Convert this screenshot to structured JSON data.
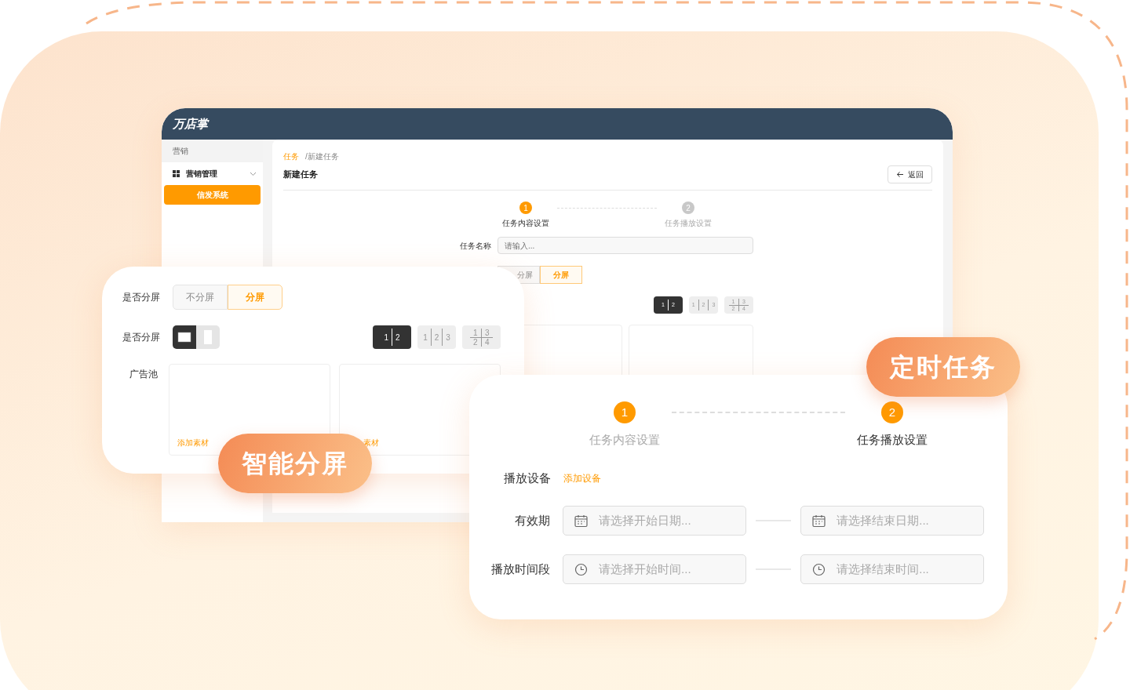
{
  "app": {
    "logo": "万店掌",
    "sidebar": {
      "section": "营销",
      "groups": [
        {
          "label": "营销管理",
          "expanded": true,
          "items": [
            {
              "label": "信发系统",
              "selected": true
            }
          ]
        }
      ]
    },
    "breadcrumb": [
      {
        "label": "任务",
        "kind": "link"
      },
      {
        "label": "/新建任务",
        "kind": "current"
      }
    ],
    "title": "新建任务",
    "back_button": "返回",
    "steps": [
      {
        "number": "1",
        "label": "任务内容设置",
        "reached": true,
        "selected": true
      },
      {
        "number": "2",
        "label": "任务播放设置",
        "reached": false,
        "selected": false
      }
    ],
    "task_name": {
      "label": "任务名称",
      "placeholder": "请输入..."
    },
    "split_options": [
      {
        "label": "分屏",
        "selected": false
      },
      {
        "label": "分屏",
        "selected": true
      }
    ],
    "layouts": [
      {
        "kind": "two",
        "cells": [
          "1",
          "2"
        ],
        "selected": true
      },
      {
        "kind": "three",
        "cells": [
          "1",
          "2",
          "3"
        ],
        "selected": false
      },
      {
        "kind": "grid",
        "cells": [
          "1",
          "3",
          "2",
          "4"
        ],
        "selected": false
      }
    ],
    "ad_slots": [
      {
        "kind": "empty"
      },
      {
        "kind": "empty"
      }
    ]
  },
  "split_card": {
    "split": {
      "label": "是否分屏",
      "options": [
        {
          "label": "不分屏",
          "selected": false
        },
        {
          "label": "分屏",
          "selected": true
        }
      ]
    },
    "orientation": {
      "label": "是否分屏",
      "options": [
        {
          "kind": "landscape",
          "selected": true
        },
        {
          "kind": "portrait",
          "selected": false
        }
      ]
    },
    "layouts": [
      {
        "kind": "two",
        "cells": [
          "1",
          "2"
        ],
        "selected": true
      },
      {
        "kind": "three",
        "cells": [
          "1",
          "2",
          "3"
        ],
        "selected": false
      },
      {
        "kind": "grid",
        "cells": [
          "1",
          "3",
          "2",
          "4"
        ],
        "selected": false
      }
    ],
    "ad_pool": {
      "label": "广告池",
      "slots": [
        {
          "action": "添加素材"
        },
        {
          "action": "素材"
        }
      ]
    },
    "badge": "智能分屏"
  },
  "schedule_card": {
    "steps": [
      {
        "number": "1",
        "label": "任务内容设置",
        "reached": true,
        "selected": false
      },
      {
        "number": "2",
        "label": "任务播放设置",
        "reached": true,
        "selected": true
      }
    ],
    "device": {
      "label": "播放设备",
      "action": "添加设备"
    },
    "ranges": [
      {
        "label": "有效期",
        "kind": "date",
        "start_placeholder": "请选择开始日期...",
        "end_placeholder": "请选择结束日期..."
      },
      {
        "label": "播放时间段",
        "kind": "time",
        "start_placeholder": "请选择开始时间...",
        "end_placeholder": "请选择结束时间..."
      }
    ],
    "badge": "定时任务"
  }
}
